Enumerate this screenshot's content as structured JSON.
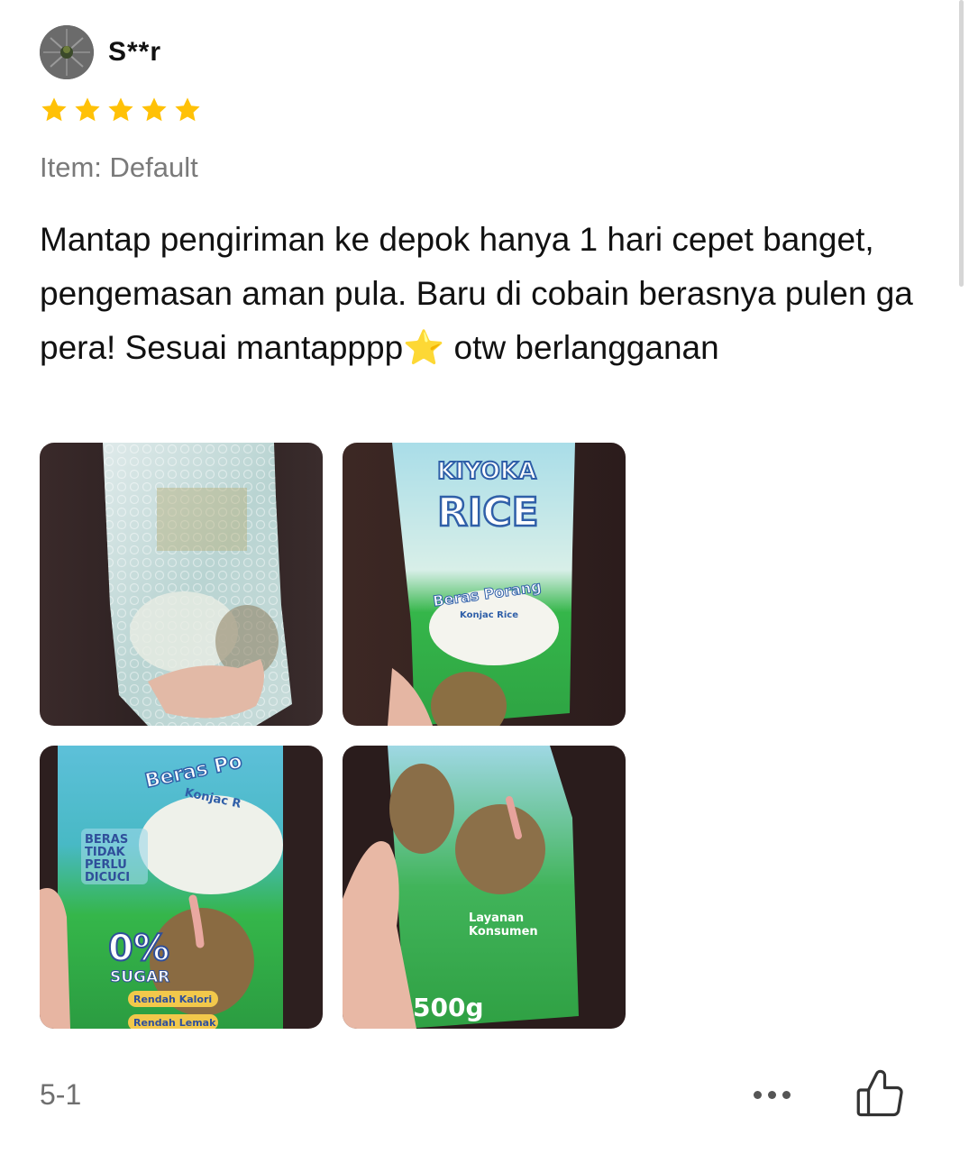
{
  "review": {
    "username": "S**r",
    "rating": 5,
    "item_variant": "Item: Default",
    "text": "Mantap pengiriman ke depok hanya 1 hari cepet banget, pengemasan aman pula. Baru di cobain berasnya pulen ga pera! Sesuai mantapppp⭐ otw berlangganan",
    "date": "5-1"
  },
  "photos": [
    {
      "name": "photo-bubble-wrapped-package",
      "labels": []
    },
    {
      "name": "photo-kiyoka-rice-front",
      "labels": [
        "KIYOKA",
        "RICE",
        "Beras Porang",
        "Konjac Rice"
      ]
    },
    {
      "name": "photo-rice-bag-sugar",
      "labels": [
        "Beras Po",
        "Konjac R",
        "BERAS",
        "TIDAK",
        "PERLU",
        "DICUCI",
        "0%",
        "SUGAR",
        "Rendah Kalori",
        "Rendah Lemak"
      ]
    },
    {
      "name": "photo-rice-bag-back",
      "labels": [
        "Layanan",
        "Konsumen",
        "500g"
      ]
    }
  ],
  "icons": {
    "star": "star-icon",
    "more": "more-dots-icon",
    "like": "thumbs-up-icon",
    "avatar": "user-avatar"
  },
  "colors": {
    "star": "#FFC107",
    "muted_text": "#7a7a7a"
  }
}
